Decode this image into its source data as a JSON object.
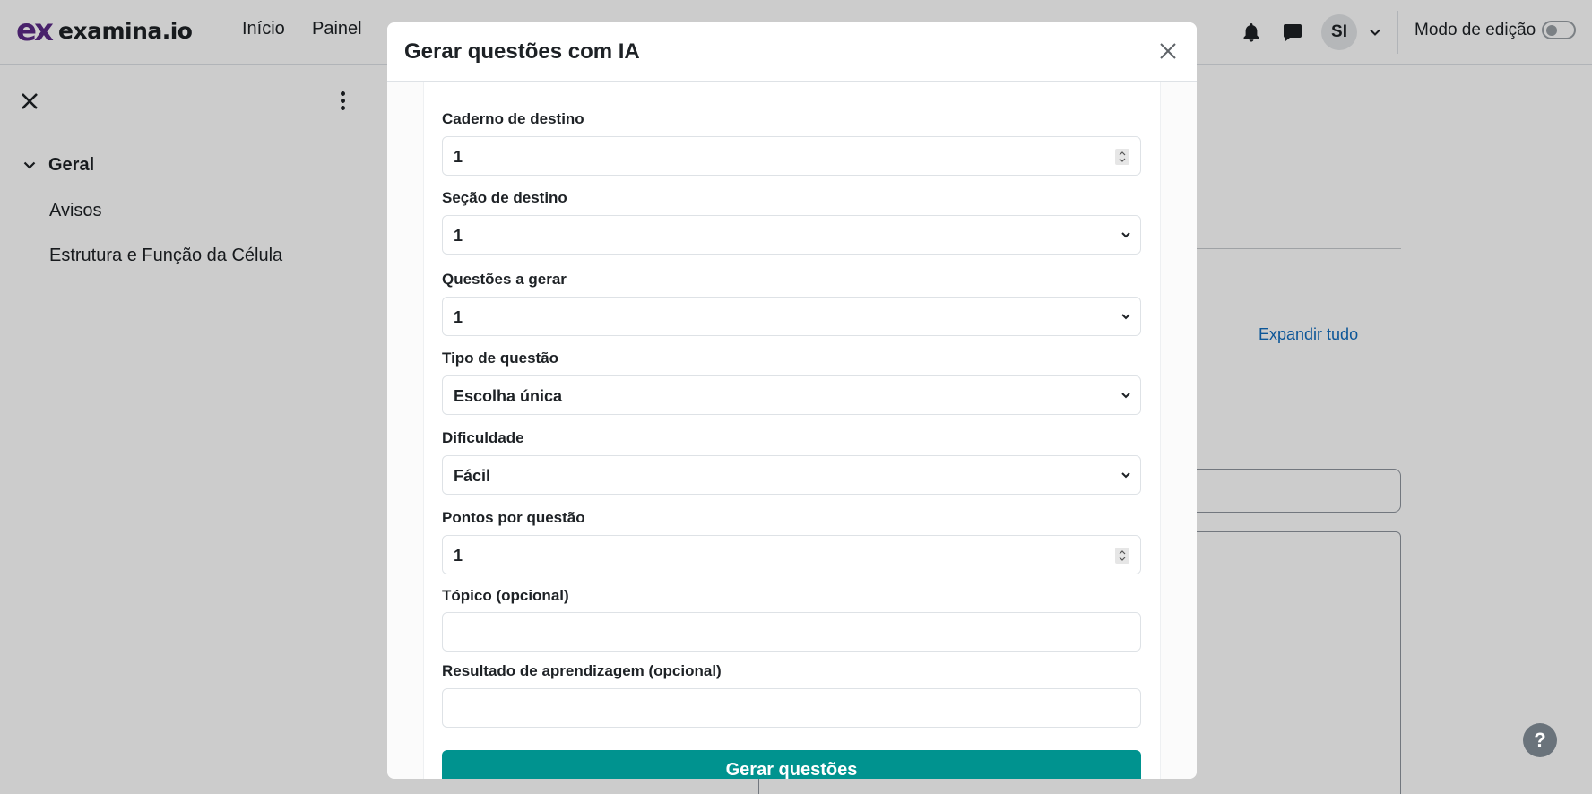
{
  "navbar": {
    "logo_mark": "ex",
    "logo_text": "examina.io",
    "links": [
      "Início",
      "Painel"
    ],
    "avatar_initials": "SI",
    "edit_mode_label": "Modo de edição",
    "edit_mode_on": false
  },
  "drawer": {
    "section_title": "Geral",
    "items": [
      "Avisos",
      "Estrutura e Função da Célula"
    ]
  },
  "page": {
    "expand_all_label": "Expandir tudo"
  },
  "help": {
    "label": "?"
  },
  "modal": {
    "title": "Gerar questões com IA",
    "fields": {
      "notebook": {
        "label": "Caderno de destino",
        "value": "1"
      },
      "section": {
        "label": "Seção de destino",
        "value": "1"
      },
      "count": {
        "label": "Questões a gerar",
        "value": "1"
      },
      "type": {
        "label": "Tipo de questão",
        "value": "Escolha única"
      },
      "difficulty": {
        "label": "Dificuldade",
        "value": "Fácil"
      },
      "points": {
        "label": "Pontos por questão",
        "value": "1"
      },
      "topic": {
        "label": "Tópico (opcional)",
        "value": ""
      },
      "outcome": {
        "label": "Resultado de aprendizagem (opcional)",
        "value": ""
      }
    },
    "submit_label": "Gerar questões"
  },
  "colors": {
    "brand": "#5b2a86",
    "primary_button": "#00938f",
    "link": "#0f6cbf"
  },
  "icons": {
    "close": "close-icon",
    "notifications": "bell-icon",
    "messages": "chat-bubble-icon",
    "menu": "kebab-icon",
    "select": "chevron-down-icon",
    "number": "spinner-arrows-icon"
  }
}
